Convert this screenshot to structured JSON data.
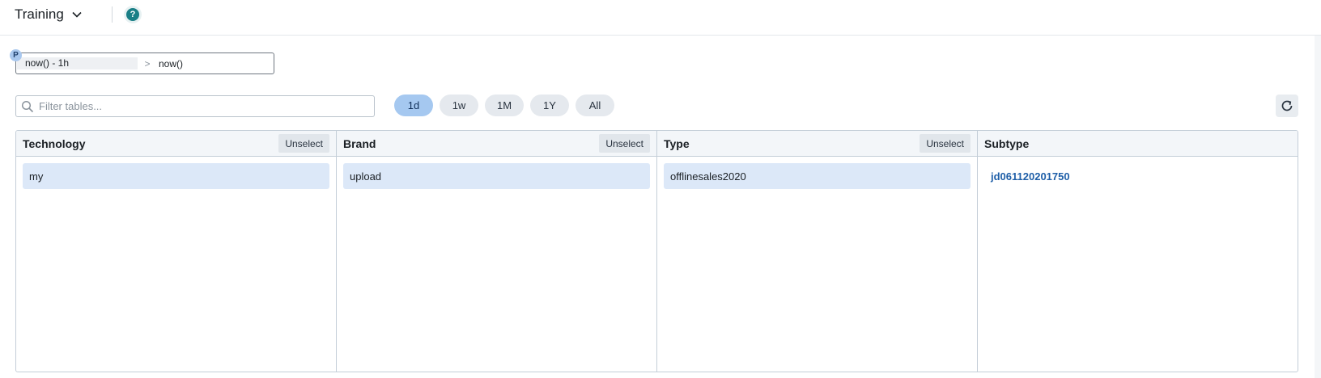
{
  "header": {
    "title": "Training"
  },
  "time_range": {
    "badge": "P",
    "from": "now() - 1h",
    "arrow": ">",
    "to": "now()"
  },
  "filter": {
    "placeholder": "Filter tables..."
  },
  "periods": [
    {
      "label": "1d",
      "active": true
    },
    {
      "label": "1w",
      "active": false
    },
    {
      "label": "1M",
      "active": false
    },
    {
      "label": "1Y",
      "active": false
    },
    {
      "label": "All",
      "active": false
    }
  ],
  "columns": [
    {
      "title": "Technology",
      "unselect_label": "Unselect",
      "items": [
        "my"
      ]
    },
    {
      "title": "Brand",
      "unselect_label": "Unselect",
      "items": [
        "upload"
      ]
    },
    {
      "title": "Type",
      "unselect_label": "Unselect",
      "items": [
        "offlinesales2020"
      ]
    },
    {
      "title": "Subtype",
      "items": [
        "jd061120201750"
      ]
    }
  ],
  "colors": {
    "accent_pill": "#a5c8f0",
    "selected_item": "#dce8f8",
    "link": "#1f5fa8",
    "help": "#1a7f86"
  }
}
